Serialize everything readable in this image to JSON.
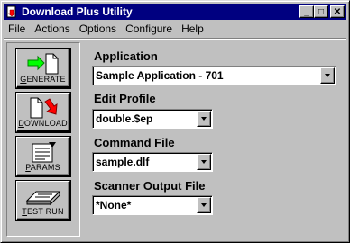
{
  "window": {
    "title": "Download Plus Utility"
  },
  "title_buttons": {
    "minimize": "_",
    "maximize": "□",
    "close": "✕"
  },
  "menu": [
    {
      "label": "File"
    },
    {
      "label": "Actions"
    },
    {
      "label": "Options"
    },
    {
      "label": "Configure"
    },
    {
      "label": "Help"
    }
  ],
  "tools": {
    "generate": "Generate",
    "download": "Download",
    "params": "Params",
    "test_run": "Test Run"
  },
  "fields": {
    "application": {
      "label": "Application",
      "value": "Sample Application - 701"
    },
    "edit_profile": {
      "label": "Edit Profile",
      "value": "double.$ep"
    },
    "command_file": {
      "label": "Command File",
      "value": "sample.dlf"
    },
    "scanner_output": {
      "label": "Scanner Output File",
      "value": "*None*"
    }
  },
  "colors": {
    "titlebar": "#000080",
    "face": "#c0c0c0"
  }
}
